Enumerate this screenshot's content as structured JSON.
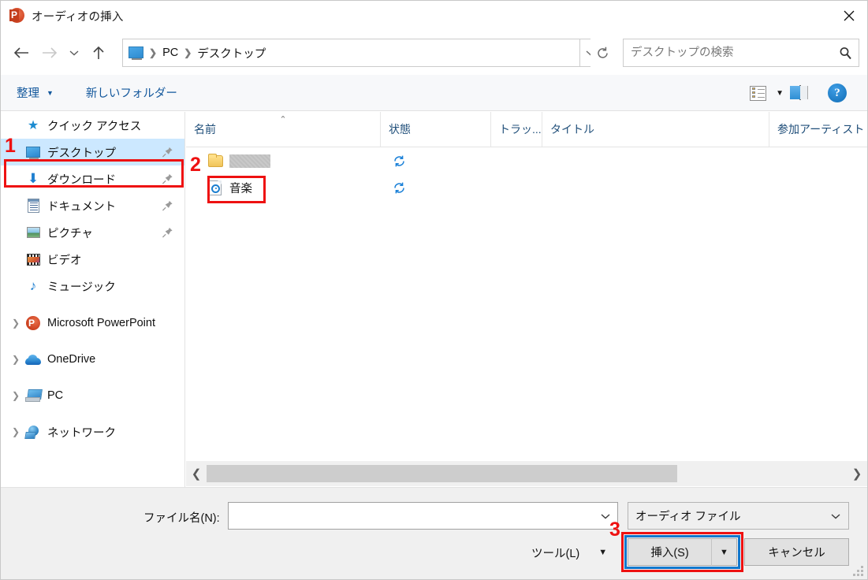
{
  "window": {
    "title": "オーディオの挿入",
    "app_icon": "powerpoint-icon",
    "close_label": "✕"
  },
  "nav": {
    "back": "←",
    "forward": "→",
    "recent": "⌄",
    "up": "↑",
    "breadcrumb": {
      "icon": "desktop-icon",
      "items": [
        "PC",
        "デスクトップ"
      ],
      "separator": "❯"
    },
    "address_dropdown": "⌄",
    "refresh": "↻"
  },
  "search": {
    "placeholder": "デスクトップの検索",
    "value": "",
    "icon": "search-icon"
  },
  "commandbar": {
    "organize": "整理",
    "organize_caret": "▼",
    "new_folder": "新しいフォルダー",
    "view_mode_icon": "view-mode-icon",
    "view_caret": "▼",
    "preview_pane_icon": "preview-pane-icon",
    "help_icon": "?"
  },
  "sidebar": {
    "items": [
      {
        "label": "クイック アクセス",
        "icon": "quick-access-star-icon",
        "chevron": "",
        "pinned": false,
        "selected": false,
        "indent": false
      },
      {
        "label": "デスクトップ",
        "icon": "desktop-icon",
        "chevron": "",
        "pinned": true,
        "selected": true,
        "indent": true
      },
      {
        "label": "ダウンロード",
        "icon": "download-icon",
        "chevron": "",
        "pinned": true,
        "selected": false,
        "indent": true
      },
      {
        "label": "ドキュメント",
        "icon": "documents-icon",
        "chevron": "",
        "pinned": true,
        "selected": false,
        "indent": true
      },
      {
        "label": "ピクチャ",
        "icon": "pictures-icon",
        "chevron": "",
        "pinned": true,
        "selected": false,
        "indent": true
      },
      {
        "label": "ビデオ",
        "icon": "videos-icon",
        "chevron": "",
        "pinned": false,
        "selected": false,
        "indent": true
      },
      {
        "label": "ミュージック",
        "icon": "music-icon",
        "chevron": "",
        "pinned": false,
        "selected": false,
        "indent": true
      },
      {
        "label": "Microsoft PowerPoint",
        "icon": "powerpoint-icon",
        "chevron": "❯",
        "pinned": false,
        "selected": false,
        "indent": false
      },
      {
        "label": "OneDrive",
        "icon": "onedrive-icon",
        "chevron": "❯",
        "pinned": false,
        "selected": false,
        "indent": false
      },
      {
        "label": "PC",
        "icon": "pc-icon",
        "chevron": "❯",
        "pinned": false,
        "selected": false,
        "indent": false
      },
      {
        "label": "ネットワーク",
        "icon": "network-icon",
        "chevron": "❯",
        "pinned": false,
        "selected": false,
        "indent": false
      }
    ]
  },
  "filelist": {
    "columns": [
      {
        "label": "名前",
        "sorted": true,
        "sort_caret": "⌃"
      },
      {
        "label": "状態",
        "sorted": false,
        "sort_caret": ""
      },
      {
        "label": "トラッ...",
        "sorted": false,
        "sort_caret": ""
      },
      {
        "label": "タイトル",
        "sorted": false,
        "sort_caret": ""
      },
      {
        "label": "参加アーティスト",
        "sorted": false,
        "sort_caret": ""
      }
    ],
    "rows": [
      {
        "name": "",
        "redacted": true,
        "icon": "folder-icon",
        "status_icon": "sync-icon"
      },
      {
        "name": "音楽",
        "redacted": false,
        "icon": "audio-file-icon",
        "status_icon": "sync-icon"
      }
    ]
  },
  "scrollbar": {
    "left_arrow": "❮",
    "right_arrow": "❯"
  },
  "bottom": {
    "filename_label": "ファイル名(N):",
    "filename_value": "",
    "filename_caret": "⌄",
    "filetype_value": "オーディオ ファイル",
    "filetype_caret": "⌄",
    "tools_label": "ツール(L)",
    "tools_caret": "▼",
    "insert_label": "挿入(S)",
    "insert_split_caret": "▼",
    "cancel_label": "キャンセル"
  },
  "annotations": {
    "markers": [
      {
        "number": "1",
        "target": "sidebar-item-desktop",
        "color": "#ee1111"
      },
      {
        "number": "2",
        "target": "file-row-ongaku",
        "color": "#ee1111"
      },
      {
        "number": "3",
        "target": "insert-button",
        "color": "#ee1111"
      }
    ],
    "highlight_colors": {
      "red": "#ee1111",
      "blue": "#1277cc"
    }
  }
}
